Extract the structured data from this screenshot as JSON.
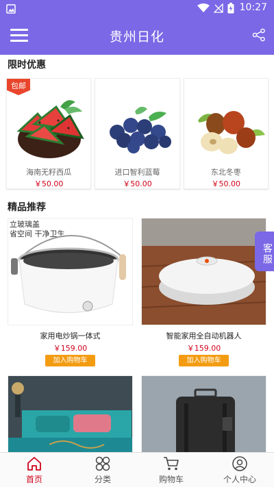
{
  "status_bar": {
    "time": "10:27"
  },
  "app_bar": {
    "title": "贵州日化"
  },
  "promo": {
    "section_title": "限时优惠",
    "items": [
      {
        "name": "海南无籽西瓜",
        "price": "￥50.00",
        "tag": "包邮"
      },
      {
        "name": "进口智利蓝莓",
        "price": "￥50.00"
      },
      {
        "name": "东北冬枣",
        "price": "￥50.00"
      }
    ]
  },
  "featured": {
    "section_title": "精品推荐",
    "add_to_cart_label": "加入购物车",
    "items": [
      {
        "name": "家用电炒锅一体式",
        "price": "￥159.00",
        "image_text": [
          "立玻璃盖",
          "省空间 干净卫生"
        ]
      },
      {
        "name": "智能家用全自动机器人",
        "price": "￥159.00"
      },
      {
        "name": "",
        "price": ""
      },
      {
        "name": "",
        "price": ""
      }
    ]
  },
  "customer_service": {
    "label": "客服"
  },
  "tabs": [
    {
      "label": "首页",
      "icon": "home-icon",
      "active": true
    },
    {
      "label": "分类",
      "icon": "category-icon",
      "active": false
    },
    {
      "label": "购物车",
      "icon": "cart-icon",
      "active": false
    },
    {
      "label": "个人中心",
      "icon": "user-icon",
      "active": false
    }
  ],
  "colors": {
    "primary": "#7b68e6",
    "price": "#d0021b",
    "button": "#f39c12",
    "tag": "#e8452c"
  }
}
